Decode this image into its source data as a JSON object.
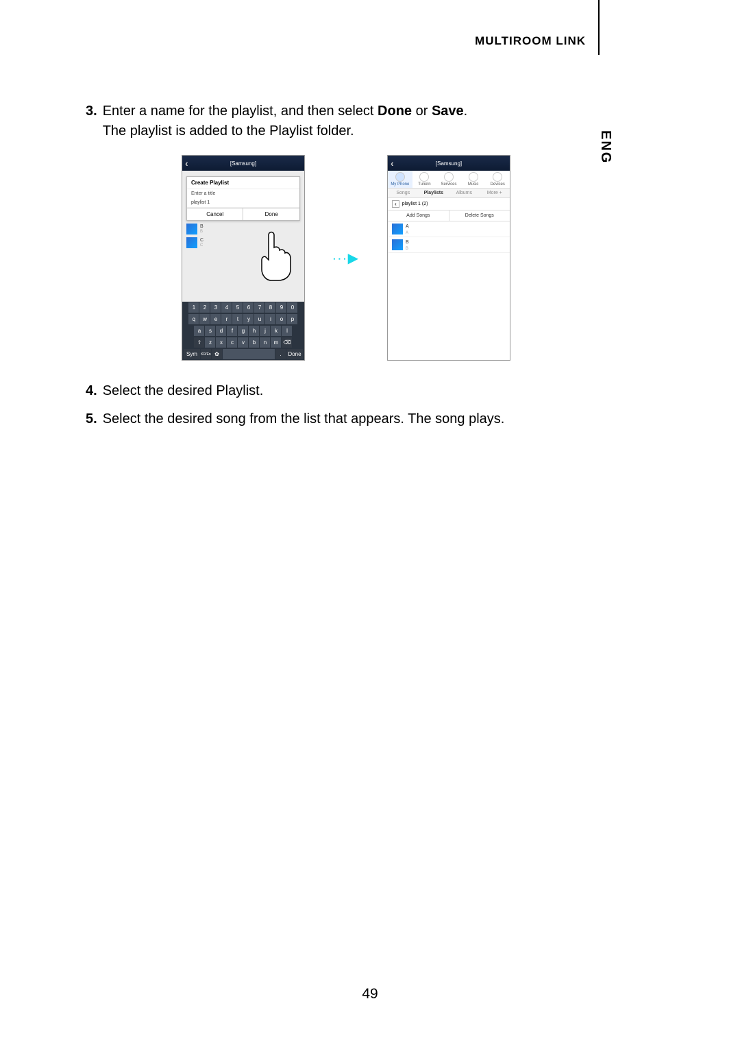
{
  "header": {
    "section": "MULTIROOM LINK",
    "lang": "ENG"
  },
  "steps": {
    "s3": {
      "num": "3.",
      "text_a": "Enter a name for the playlist, and then select ",
      "bold1": "Done",
      "mid": " or ",
      "bold2": "Save",
      "end": ".",
      "line2": "The playlist is added to the Playlist folder."
    },
    "s4": {
      "num": "4.",
      "text": "Select the desired Playlist."
    },
    "s5": {
      "num": "5.",
      "text": "Select the desired song from the list that appears. The song plays."
    }
  },
  "arrow": "∙∙∙▶",
  "screen1": {
    "title": "[Samsung]",
    "dialog_title": "Create Playlist",
    "hint": "Enter a title",
    "input": "playlist 1",
    "cancel": "Cancel",
    "done": "Done",
    "bg_songs": [
      {
        "t": "B",
        "s": "B"
      },
      {
        "t": "C",
        "s": "C"
      }
    ],
    "kb_row1": [
      "1",
      "2",
      "3",
      "4",
      "5",
      "6",
      "7",
      "8",
      "9",
      "0"
    ],
    "kb_row2": [
      "q",
      "w",
      "e",
      "r",
      "t",
      "y",
      "u",
      "i",
      "o",
      "p"
    ],
    "kb_row3": [
      "a",
      "s",
      "d",
      "f",
      "g",
      "h",
      "j",
      "k",
      "l"
    ],
    "kb_row4_shift": "⇧",
    "kb_row4": [
      "z",
      "x",
      "c",
      "v",
      "b",
      "n",
      "m"
    ],
    "kb_row4_bksp": "⌫",
    "kb_bottom": {
      "sym": "Sym",
      "lang": "KR/En",
      "gear": "✿",
      "dot": ".",
      "done": "Done"
    }
  },
  "screen2": {
    "title": "[Samsung]",
    "tabs": [
      "My Phone",
      "TuneIn",
      "Services",
      "Music",
      "Devices"
    ],
    "subtabs": [
      "Songs",
      "Playlists",
      "Albums",
      "More +"
    ],
    "subtab_active": 1,
    "playlist_label": "playlist 1 (2)",
    "add": "Add Songs",
    "del": "Delete Songs",
    "songs": [
      {
        "t": "A",
        "s": "A"
      },
      {
        "t": "B",
        "s": "B"
      }
    ]
  },
  "page": "49"
}
